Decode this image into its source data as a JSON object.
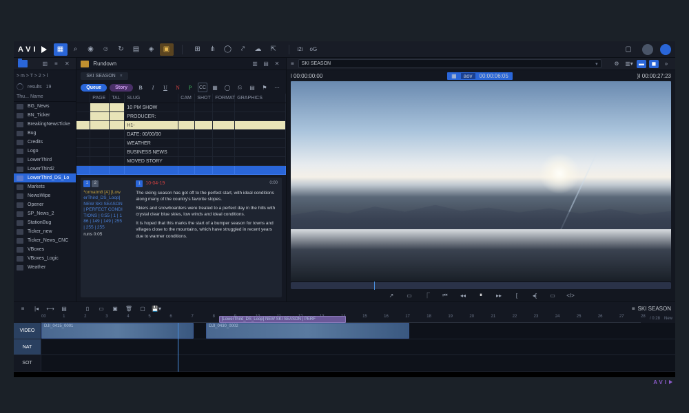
{
  "logo": "AVI",
  "toolbar": {
    "txt1": "i2i",
    "txt2": "oG"
  },
  "browser": {
    "crumbs": "> m > T > 2 > l",
    "results_label": "results",
    "results_count": "19",
    "col_thumb": "Thu...",
    "col_name": "Name",
    "items": [
      "BG_News",
      "BN_Ticker",
      "BreakingNewsTicke",
      "Bug",
      "Credits",
      "Logo",
      "LowerThird",
      "LowerThird2",
      "LowerThird_DS_Lo",
      "Markets",
      "NewsWipe",
      "Opener",
      "SP_News_2",
      "StationBug",
      "Ticker_new",
      "Ticker_News_CNC",
      "VBoxes",
      "VBoxes_Logic",
      "Weather"
    ]
  },
  "rundown": {
    "title": "Rundown",
    "tab": "SKI SEASON",
    "pill_queue": "Queue",
    "pill_story": "Story",
    "cols": {
      "page": "PAGE",
      "tal": "TAL",
      "slug": "SLUG",
      "cam": "CAM",
      "shot": "SHOT",
      "format": "FORMAT",
      "gfx": "GRAPHICS"
    },
    "rows": [
      {
        "slug": "10 PM SHOW"
      },
      {
        "slug": "PRODUCER:"
      },
      {
        "slug": "H1-",
        "hl": true
      },
      {
        "slug": "DATE: 00/00/00"
      },
      {
        "slug": "WEATHER"
      },
      {
        "slug": "BUSINESS NEWS"
      },
      {
        "slug": "MOVED STORY"
      },
      {
        "slug": "",
        "sel": true
      }
    ]
  },
  "script": {
    "meta_line1": "*ormatm8 [A] [Low",
    "meta_line2": "erThird_DS_Loop]",
    "meta_line3": "NEW SKI SEASON",
    "meta_line4": "| PERFECT CONDI",
    "meta_line5": "TIONS | 0:55 | 1 | 1",
    "meta_line6": "86 | 149 | 149 | 255",
    "meta_line7": "| 255 | 255",
    "meta_runs": "runs 0:05",
    "red_label": "10-04-19",
    "dur": "0:00",
    "p1": "The skiing season has got off to the perfect start, with ideal conditions along many of the country's favorite slopes.",
    "p2": "Skiers and snowboarders were treated to a perfect day in the hills with crystal clear blue skies, low winds and ideal conditions.",
    "p3": "It is hoped that this marks the start of a bumper season for towns and villages close to the mountains, which have struggled in recent years due to warmer conditions."
  },
  "viewer": {
    "seq_name": "SKI SEASON",
    "tc_left": "l  00:00:00:00",
    "tc_mid_name": "aov",
    "tc_mid": "00:00:06:05",
    "tc_right": "}I  00:00:27:23"
  },
  "timeline": {
    "seq_name": "SKI SEASON",
    "total": "/ 0:28",
    "new_label": "New",
    "tracks": {
      "video": "VIDEO",
      "nat": "NAT",
      "sot": "SOT"
    },
    "ticks": [
      "00",
      "1",
      "2",
      "3",
      "4",
      "5",
      "6",
      "7",
      "8",
      "9",
      "10",
      "11",
      "12",
      "13",
      "14",
      "15",
      "16",
      "17",
      "18",
      "19",
      "20",
      "21",
      "22",
      "23",
      "24",
      "25",
      "26",
      "27",
      "28"
    ],
    "clip1": "DJI_0415_0001",
    "clip2": "DJI_0430_0002",
    "gfx_clip": "[LowerThird_DS_Loop] NEW SKI SEASON | PERF"
  },
  "footer": "AVI"
}
